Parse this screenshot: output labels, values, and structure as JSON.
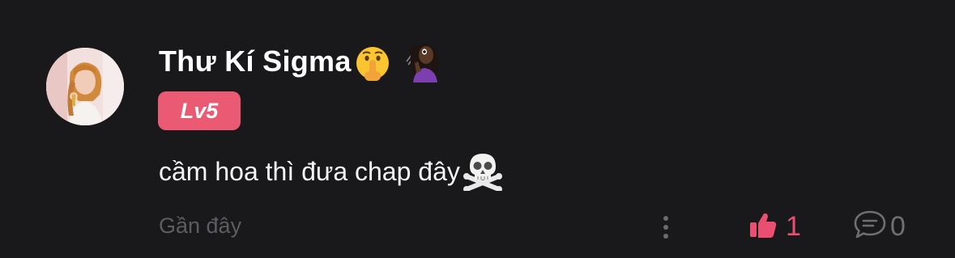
{
  "comment": {
    "avatar_icon": "user-avatar-photo",
    "username": "Thư Kí Sigma",
    "username_emojis": [
      "shushing-face",
      "woman-tipping-hand"
    ],
    "level_badge": "Lv5",
    "text": "cầm hoa thì đưa chap đây",
    "text_emoji": "skull-and-crossbones",
    "timestamp": "Gần đây",
    "like_count": "1",
    "reply_count": "0"
  },
  "colors": {
    "background": "#19181a",
    "badge": "#ea5a73",
    "like_accent": "#ea4f72",
    "muted": "#5d5c60"
  }
}
